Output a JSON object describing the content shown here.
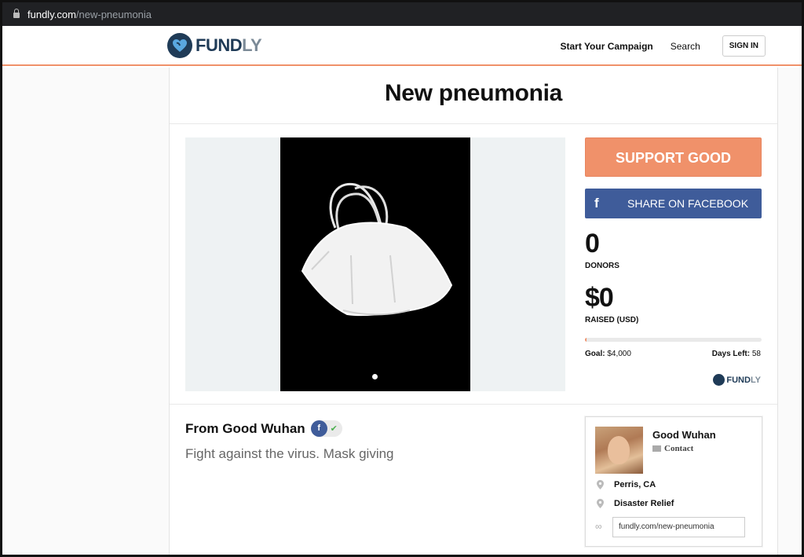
{
  "browser": {
    "url_host": "fundly.com",
    "url_path": "/new-pneumonia"
  },
  "header": {
    "logo_main": "FUND",
    "logo_accent": "LY",
    "nav": {
      "start_campaign": "Start Your Campaign",
      "search": "Search",
      "sign_in": "SIGN IN"
    }
  },
  "campaign": {
    "title": "New pneumonia",
    "support_label": "SUPPORT GOOD",
    "facebook_label": "SHARE ON FACEBOOK",
    "donors_count": "0",
    "donors_label": "DONORS",
    "raised_amount": "$0",
    "raised_label": "RAISED (USD)",
    "progress_fraction": 0.01,
    "goal_label": "Goal:",
    "goal_value": "$4,000",
    "days_left_label": "Days Left:",
    "days_left_value": "58",
    "footer_logo_main": "FUND",
    "footer_logo_accent": "LY"
  },
  "story": {
    "from_text": "From Good Wuhan",
    "description": "Fight against the virus. Mask giving"
  },
  "organizer": {
    "name": "Good Wuhan",
    "contact_label": "Contact",
    "location": "Perris, CA",
    "category": "Disaster Relief",
    "link": "fundly.com/new-pneumonia"
  },
  "colors": {
    "accent": "#f0916a",
    "facebook": "#3f5c9a",
    "brand_dark": "#1f3b57"
  }
}
